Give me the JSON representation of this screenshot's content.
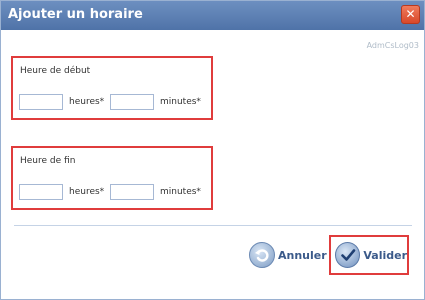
{
  "dialog": {
    "title": "Ajouter un horaire",
    "close_icon": "close-icon",
    "code": "AdmCsLog03"
  },
  "start_time": {
    "label": "Heure de début",
    "hours_value": "",
    "hours_unit": "heures*",
    "minutes_value": "",
    "minutes_unit": "minutes*"
  },
  "end_time": {
    "label": "Heure de fin",
    "hours_value": "",
    "hours_unit": "heures*",
    "minutes_value": "",
    "minutes_unit": "minutes*"
  },
  "buttons": {
    "cancel_label": "Annuler",
    "cancel_icon": "undo-icon",
    "validate_label": "Valider",
    "validate_icon": "checkmark-icon"
  }
}
